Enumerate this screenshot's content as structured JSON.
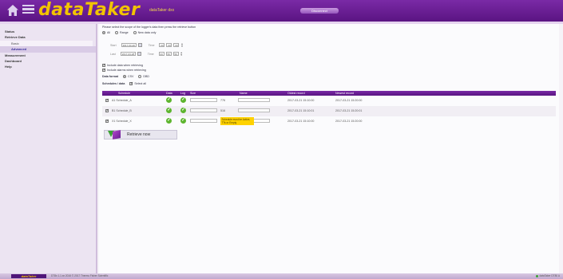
{
  "header": {
    "logo": "dataTaker",
    "logo_suffix": "dataTaker dxx",
    "tab": "Disconnect"
  },
  "sidebar": {
    "items": [
      {
        "label": "Status"
      },
      {
        "label": "Retrieve Data"
      },
      {
        "label": "Basic"
      },
      {
        "label": "Advanced"
      },
      {
        "label": "Measurement"
      },
      {
        "label": "Dashboard"
      },
      {
        "label": "Help"
      }
    ]
  },
  "form": {
    "instruction": "Please select the scope of the logger's data then press the retrieve button",
    "scope_all": "All",
    "scope_range": "Range",
    "scope_new": "New data only",
    "start_label": "Start",
    "start_date": "2017-03-20",
    "end_label": "Last",
    "end_date": "2017-03-28",
    "time_label": "Time",
    "start_time": [
      "00",
      "00",
      "00"
    ],
    "end_time": [
      "23",
      "59",
      "59"
    ],
    "include_header": "Include data when retrieving",
    "include_alarms": "Include alarms when retrieving",
    "format_label": "Data format",
    "format_csv": "CSV",
    "format_dbd": "DBD",
    "schedules_label": "Schedules / data",
    "select_all": "Select all"
  },
  "table": {
    "headers": [
      "Schedule",
      "Data",
      "Log",
      "Size",
      "Name",
      "Oldest record",
      "Newest record"
    ],
    "rows": [
      {
        "schedule": "A1 Schedule_A",
        "size": "776",
        "oldest": "2017-03-21 15:10:00",
        "newest": "2017-03-21 15:20:00"
      },
      {
        "schedule": "B1 Schedule_B",
        "size": "516",
        "oldest": "2017-03-21 15:10:01",
        "newest": "2017-03-21 15:20:01"
      },
      {
        "schedule": "X1 Schedule_X",
        "size": "",
        "oldest": "2017-03-21 15:10:00",
        "newest": "2017-03-21 15:20:00"
      }
    ],
    "tooltip": "Schedule must be Active, TTs or Empty"
  },
  "retrieve": {
    "label": "Retrieve now"
  },
  "footer": {
    "logo": "dataTaker",
    "text": "DT8x 1.1.xx 2016 © 2017 Thermo Fisher Scientific",
    "status": "dataTaker DT80 A"
  },
  "colors": {
    "header": "#6a1f95",
    "logo": "#f2c400",
    "ok": "#5db52e",
    "tooltip": "#ffd200"
  }
}
